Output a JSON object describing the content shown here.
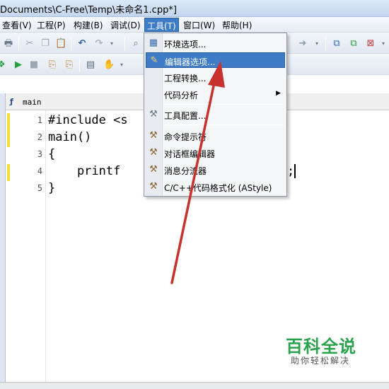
{
  "window": {
    "title": "Documents\\C-Free\\Temp\\未命名1.cpp*]"
  },
  "menubar": {
    "items": [
      {
        "label": "查看(V)"
      },
      {
        "label": "工程(P)"
      },
      {
        "label": "构建(B)"
      },
      {
        "label": "调试(D)"
      },
      {
        "label": "工具(T)"
      },
      {
        "label": "窗口(W)"
      },
      {
        "label": "帮助(H)"
      }
    ],
    "active_index": 4
  },
  "function_bar": {
    "function_name": "main"
  },
  "editor": {
    "line_numbers": [
      "1",
      "2",
      "3",
      "4",
      "5"
    ],
    "lines": [
      "#include <s",
      "main()",
      "{",
      "    printf",
      "}"
    ],
    "line4_tail": ";",
    "modified_lines": [
      1,
      2,
      4
    ]
  },
  "tools_menu": {
    "items": [
      {
        "label": "环境选项...",
        "icon": "environment-options-icon"
      },
      {
        "label": "编辑器选项...",
        "icon": "editor-options-icon",
        "highlighted": true
      },
      {
        "label": "工程转换...",
        "icon": ""
      },
      {
        "label": "代码分析",
        "icon": "",
        "submenu": true
      },
      {
        "label": "工具配置...",
        "icon": "tools-config-icon"
      },
      {
        "label": "命令提示符",
        "icon": "hammer-icon"
      },
      {
        "label": "对话框编辑器",
        "icon": "hammer-icon"
      },
      {
        "label": "消息分流器",
        "icon": "hammer-icon"
      },
      {
        "label": "C/C++代码格式化 (AStyle)",
        "icon": "hammer-icon"
      }
    ]
  },
  "watermark": {
    "title": "百科全说",
    "subtitle": "助你轻松解决"
  },
  "colors": {
    "menu_highlight": "#3f7cc8",
    "annotation_arrow": "#c8322c",
    "watermark_green": "#2aa14c",
    "modified_marker": "#f4dd35"
  }
}
